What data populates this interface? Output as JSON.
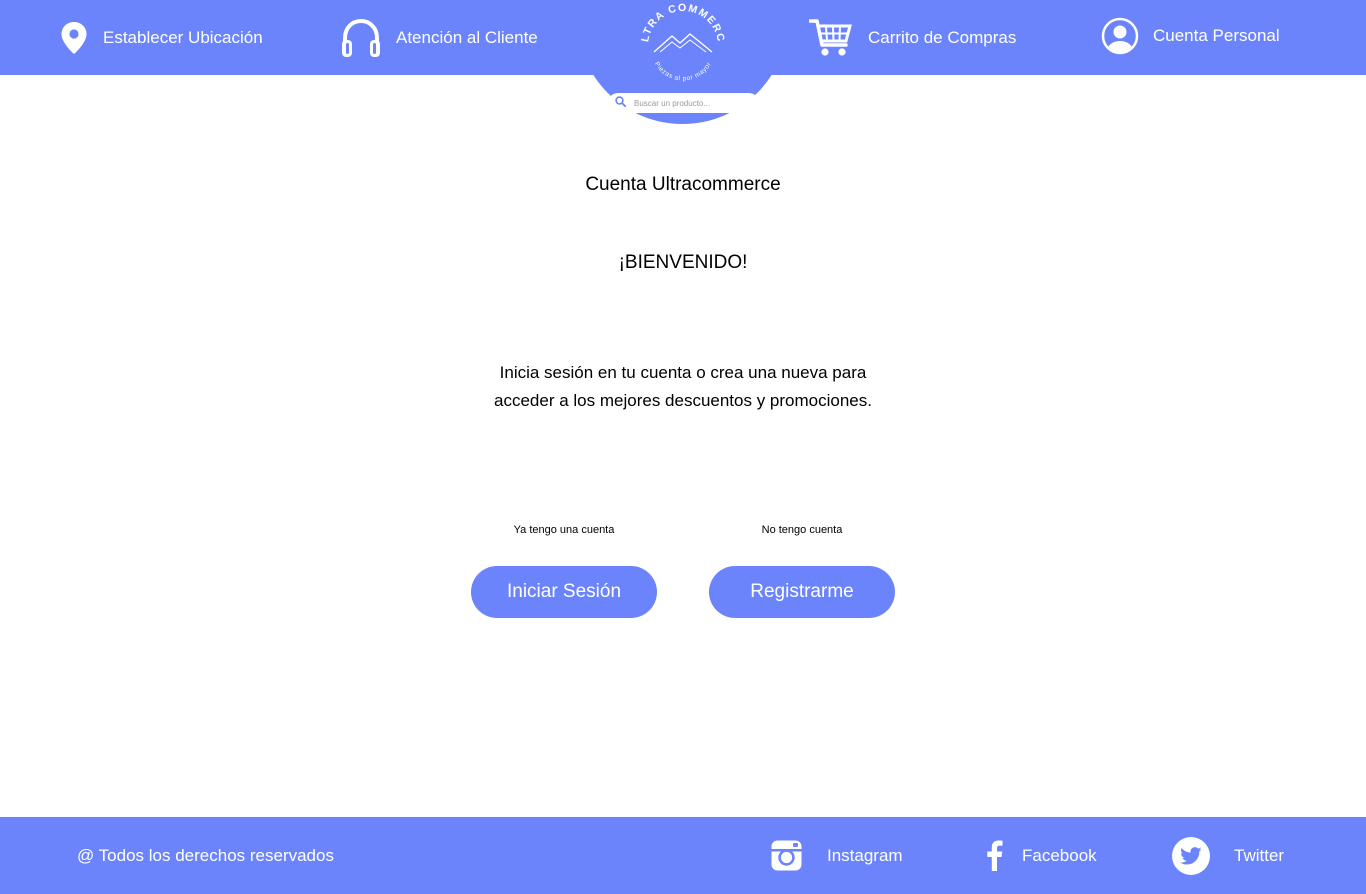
{
  "header": {
    "nav": {
      "location": {
        "label": "Establecer Ubicación",
        "icon": "location-pin-icon"
      },
      "support": {
        "label": "Atención al Cliente",
        "icon": "headphones-icon"
      },
      "cart": {
        "label": "Carrito de Compras",
        "icon": "shopping-cart-icon"
      },
      "account": {
        "label": "Cuenta Personal",
        "icon": "user-avatar-icon"
      }
    },
    "logo": {
      "top_text": "ULTRA COMMERCE",
      "bottom_text": "Piezas al por mayor"
    },
    "search": {
      "placeholder": "Buscar un producto...",
      "icon": "search-icon"
    }
  },
  "main": {
    "title": "Cuenta Ultracommerce",
    "welcome": "¡BIENVENIDO!",
    "description": "Inicia sesión en tu cuenta o crea una nueva para acceder a los mejores descuentos y promociones.",
    "login": {
      "caption": "Ya tengo una cuenta",
      "button_label": "Iniciar Sesión"
    },
    "register": {
      "caption": "No tengo cuenta",
      "button_label": "Registrarme"
    }
  },
  "footer": {
    "copyright": "@ Todos los derechos reservados",
    "social": [
      {
        "label": "Instagram",
        "icon": "instagram-icon"
      },
      {
        "label": "Facebook",
        "icon": "facebook-icon"
      },
      {
        "label": "Twitter",
        "icon": "twitter-icon"
      }
    ]
  },
  "colors": {
    "brand": "#6b84fb",
    "background": "#ffffff",
    "text": "#000000",
    "on_brand": "#ffffff"
  }
}
